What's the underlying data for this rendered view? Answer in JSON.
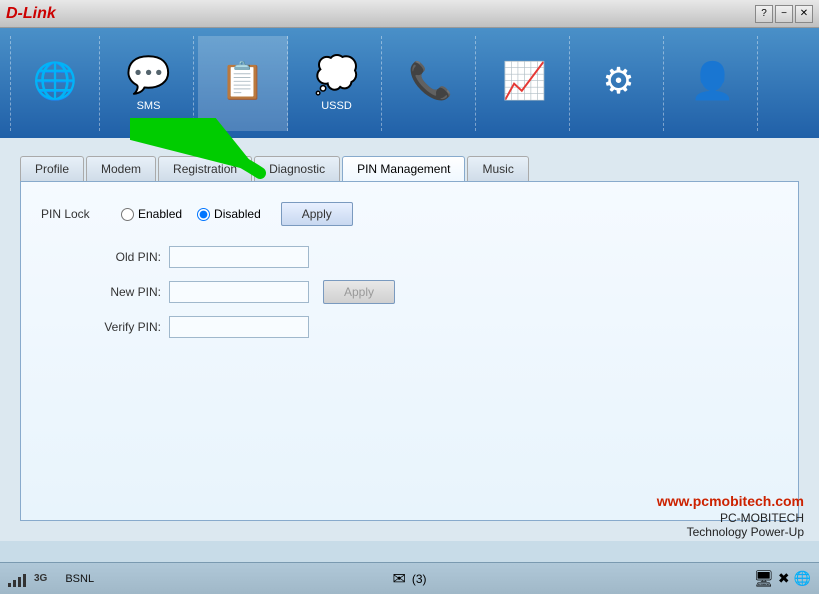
{
  "titleBar": {
    "logo": "D-Link",
    "logoAccent": "D-",
    "helpButton": "?",
    "minimizeButton": "−",
    "closeButton": "✕"
  },
  "navBar": {
    "items": [
      {
        "id": "internet",
        "label": "",
        "icon": "🌐"
      },
      {
        "id": "sms",
        "label": "SMS",
        "icon": "💬"
      },
      {
        "id": "contacts",
        "label": "",
        "icon": "📋",
        "active": true
      },
      {
        "id": "ussd",
        "label": "USSD",
        "icon": "💭"
      },
      {
        "id": "dial",
        "label": "",
        "icon": "📞"
      },
      {
        "id": "stats",
        "label": "",
        "icon": "📈"
      },
      {
        "id": "settings",
        "label": "",
        "icon": "⚙"
      },
      {
        "id": "help",
        "label": "",
        "icon": "👤"
      }
    ]
  },
  "tabs": [
    {
      "id": "profile",
      "label": "Profile"
    },
    {
      "id": "modem",
      "label": "Modem"
    },
    {
      "id": "registration",
      "label": "Registration"
    },
    {
      "id": "diagnostic",
      "label": "Diagnostic"
    },
    {
      "id": "pin-management",
      "label": "PIN Management",
      "active": true
    },
    {
      "id": "music",
      "label": "Music"
    }
  ],
  "pinManagement": {
    "lockLabel": "PIN Lock",
    "enabledLabel": "Enabled",
    "disabledLabel": "Disabled",
    "disabledSelected": true,
    "applyButtonLabel": "Apply",
    "applyPinButtonLabel": "Apply",
    "applyPinButtonDisabled": true,
    "oldPinLabel": "Old PIN:",
    "newPinLabel": "New PIN:",
    "verifyPinLabel": "Verify PIN:",
    "oldPinValue": "",
    "newPinValue": "",
    "verifyPinValue": ""
  },
  "watermark": {
    "url": "www.pcmobitech.com",
    "logoText": "PC-MOBITECH",
    "tagline": "Technology Power-Up"
  },
  "statusBar": {
    "signal": "4 bars",
    "networkType": "3G",
    "carrier": "BSNL",
    "messageCount": "(3)",
    "messageIcon": "✉"
  }
}
